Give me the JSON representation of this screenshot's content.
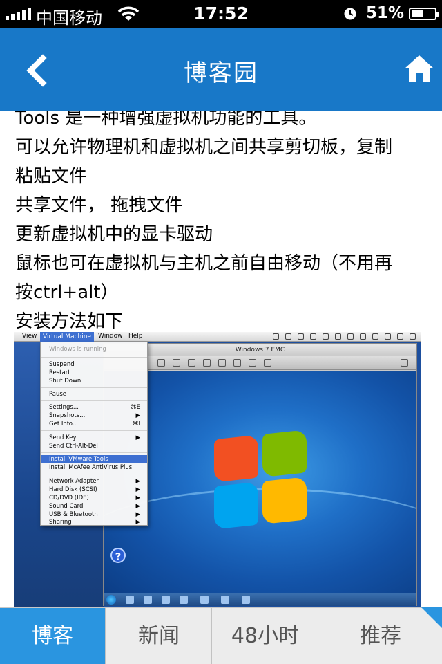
{
  "status_bar": {
    "carrier": "中国移动",
    "time": "17:52",
    "battery_percent": "51%",
    "battery_level": 0.51,
    "signal_icon": "signal-bars-icon",
    "wifi_icon": "wifi-icon",
    "clock_icon": "alarm-clock-icon"
  },
  "nav": {
    "title": "博客园",
    "back_icon": "back-chevron-icon",
    "home_icon": "home-icon",
    "color": "#1878c8"
  },
  "article": {
    "lines": [
      "Tools 是一种增强虚拟机功能的工具。",
      "可以允许物理机和虚拟机之间共享剪切板，复制",
      "粘贴文件",
      "共享文件， 拖拽文件",
      "更新虚拟机中的显卡驱动",
      "鼠标也可在虚拟机与主机之前自由移动（不用再",
      "按ctrl+alt）",
      "安装方法如下"
    ]
  },
  "screenshot": {
    "menubar": {
      "items": [
        "View",
        "Virtual Machine",
        "Window",
        "Help"
      ],
      "active": "Virtual Machine"
    },
    "vm_window_title": "Windows 7 EMC",
    "menu": {
      "status": "Windows is running",
      "items": [
        {
          "label": "Suspend",
          "shortcut": ""
        },
        {
          "label": "Restart",
          "shortcut": ""
        },
        {
          "label": "Shut Down",
          "shortcut": ""
        },
        {
          "label": "Pause",
          "shortcut": ""
        },
        {
          "label": "Settings...",
          "shortcut": "⌘E"
        },
        {
          "label": "Snapshots...",
          "shortcut": "▶"
        },
        {
          "label": "Get Info...",
          "shortcut": "⌘I"
        },
        {
          "label": "Send Key",
          "shortcut": "▶"
        },
        {
          "label": "Send Ctrl-Alt-Del",
          "shortcut": ""
        },
        {
          "label": "Install VMware Tools",
          "shortcut": ""
        },
        {
          "label": "Install McAfee AntiVirus Plus",
          "shortcut": ""
        },
        {
          "label": "Network Adapter",
          "shortcut": "▶"
        },
        {
          "label": "Hard Disk (SCSI)",
          "shortcut": "▶"
        },
        {
          "label": "CD/DVD (IDE)",
          "shortcut": "▶"
        },
        {
          "label": "Sound Card",
          "shortcut": "▶"
        },
        {
          "label": "USB & Bluetooth",
          "shortcut": "▶"
        },
        {
          "label": "Sharing",
          "shortcut": "▶"
        }
      ],
      "selected": "Install VMware Tools"
    }
  },
  "tabs": [
    {
      "label": "博客",
      "active": true
    },
    {
      "label": "新闻",
      "active": false
    },
    {
      "label": "48小时",
      "active": false
    },
    {
      "label": "推荐",
      "active": false
    }
  ],
  "colors": {
    "accent": "#1878c8",
    "tab_active": "#2a95e0",
    "menu_highlight": "#3d6fd1"
  }
}
